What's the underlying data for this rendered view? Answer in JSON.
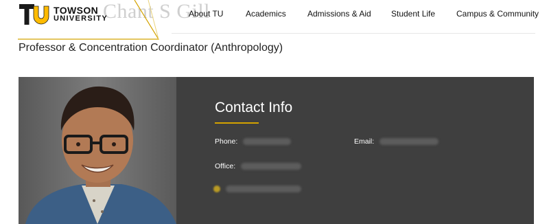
{
  "header": {
    "background_name": "Chant S Gill",
    "logo": {
      "line1": "TOWSON",
      "line2": "UNIVERSITY"
    },
    "nav": [
      "About TU",
      "Academics",
      "Admissions & Aid",
      "Student Life",
      "Campus & Community"
    ]
  },
  "page": {
    "subtitle": "Professor & Concentration Coordinator (Anthropology)"
  },
  "contact": {
    "heading": "Contact Info",
    "phone_label": "Phone:",
    "email_label": "Email:",
    "office_label": "Office:"
  },
  "colors": {
    "gold": "#ffbb00",
    "band": "#3f3f3f",
    "rule": "#d4a300"
  }
}
